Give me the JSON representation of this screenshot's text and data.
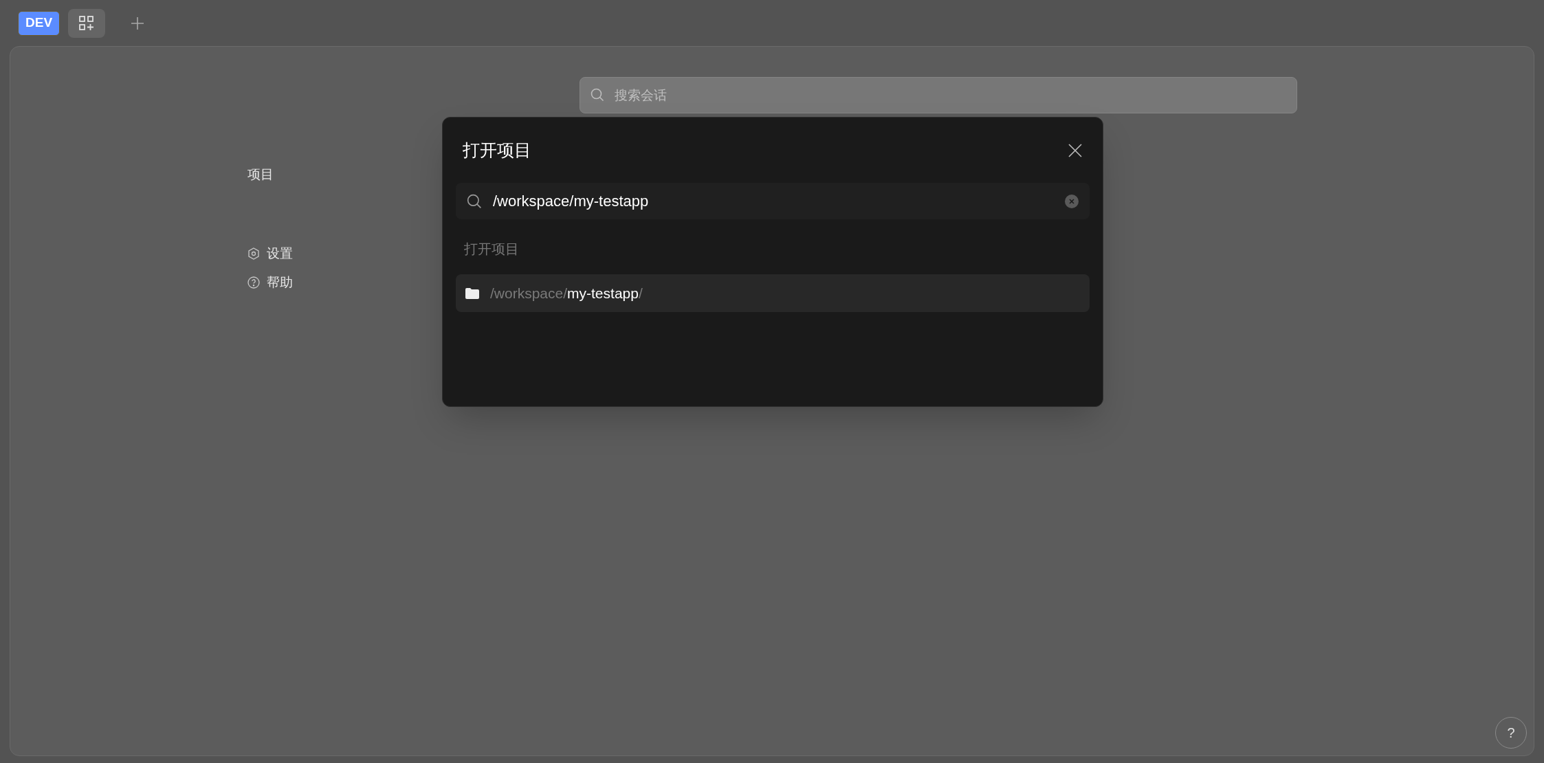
{
  "top_bar": {
    "env_badge": "DEV"
  },
  "sidebar": {
    "section_label": "项目",
    "items": [
      {
        "label": "设置",
        "kind": "settings"
      },
      {
        "label": "帮助",
        "kind": "help"
      }
    ]
  },
  "session_search": {
    "placeholder": "搜索会话"
  },
  "dialog": {
    "title": "打开项目",
    "search": {
      "value": "/workspace/my-testapp"
    },
    "section_label": "打开项目",
    "results": [
      {
        "prefix": "/workspace/",
        "match": "my-testapp",
        "suffix": "/",
        "selected": true
      }
    ]
  },
  "help_button": "?"
}
